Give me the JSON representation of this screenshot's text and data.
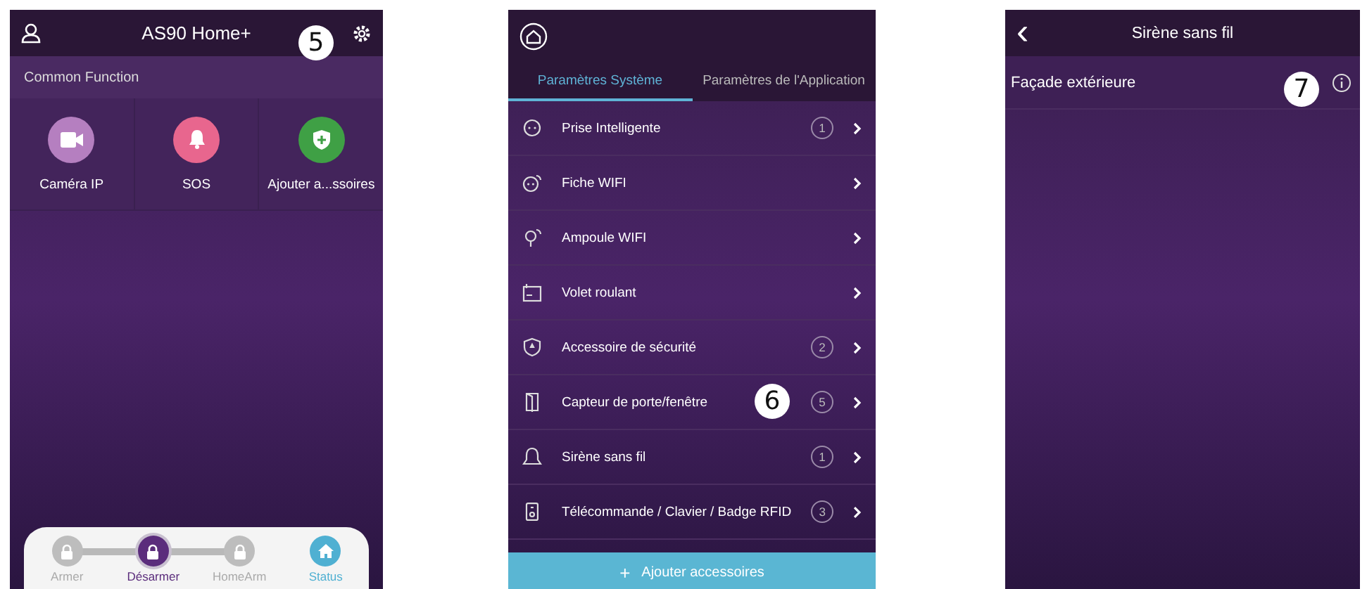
{
  "home_screen": {
    "title": "AS90 Home+",
    "section_title": "Common Function",
    "functions": [
      {
        "label": "Caméra IP",
        "color": "#b57fc0"
      },
      {
        "label": "SOS",
        "color": "#e8668e"
      },
      {
        "label": "Ajouter a...ssoires",
        "color": "#3fa045"
      }
    ],
    "modes": [
      {
        "label": "Armer",
        "selected": false
      },
      {
        "label": "Désarmer",
        "selected": true
      },
      {
        "label": "HomeArm",
        "selected": false
      },
      {
        "label": "Status",
        "selected": false
      }
    ],
    "callout": "5"
  },
  "settings_screen": {
    "tabs": [
      {
        "label": "Paramètres Système",
        "selected": true
      },
      {
        "label": "Paramètres de l'Application",
        "selected": false
      }
    ],
    "items": [
      {
        "label": "Prise Intelligente",
        "count": "1"
      },
      {
        "label": "Fiche WIFI"
      },
      {
        "label": "Ampoule WIFI"
      },
      {
        "label": "Volet roulant"
      },
      {
        "label": "Accessoire de sécurité",
        "count": "2"
      },
      {
        "label": "Capteur de porte/fenêtre",
        "count": "5"
      },
      {
        "label": "Sirène sans fil",
        "count": "1"
      },
      {
        "label": "Télécommande / Clavier / Badge RFID",
        "count": "3"
      }
    ],
    "add_button": "Ajouter accessoires",
    "add_icon": "+",
    "callout": "6"
  },
  "siren_screen": {
    "title": "Sirène sans fil",
    "back": "‹",
    "items": [
      {
        "label": "Façade extérieure"
      }
    ],
    "callout": "7"
  }
}
